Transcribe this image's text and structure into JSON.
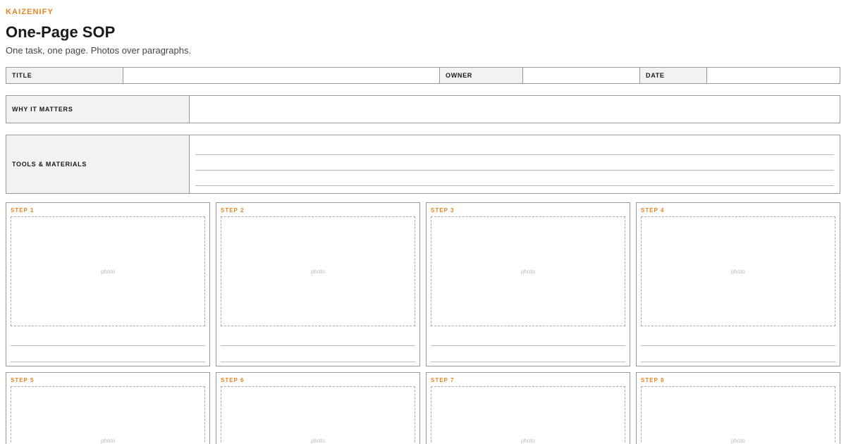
{
  "brand": "KAIZENIFY",
  "header": {
    "title": "One-Page SOP",
    "subtitle": "One task, one page. Photos over paragraphs."
  },
  "meta": {
    "title_label": "TITLE",
    "title_value": "",
    "owner_label": "OWNER",
    "owner_value": "",
    "date_label": "DATE",
    "date_value": ""
  },
  "why": {
    "label": "WHY IT MATTERS",
    "value": ""
  },
  "tools": {
    "label": "TOOLS & MATERIALS"
  },
  "photo_placeholder": "photo",
  "steps": [
    {
      "label": "STEP 1"
    },
    {
      "label": "STEP 2"
    },
    {
      "label": "STEP 3"
    },
    {
      "label": "STEP 4"
    },
    {
      "label": "STEP 5"
    },
    {
      "label": "STEP 6"
    },
    {
      "label": "STEP 7"
    },
    {
      "label": "STEP 8"
    }
  ],
  "colors": {
    "accent": "#e8831f",
    "label_bg": "#f2f2f2",
    "border": "#999999"
  }
}
